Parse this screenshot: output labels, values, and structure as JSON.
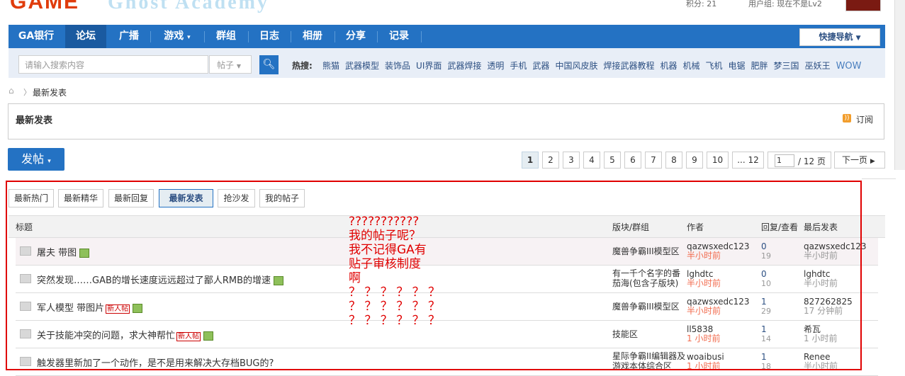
{
  "header": {
    "logo_text": "GAME",
    "logo_sub": "Ghost Academy",
    "credits": "积分: 21",
    "user_group": "用户组: 现在不是Lv2"
  },
  "nav": {
    "items": [
      "GA银行",
      "论坛",
      "广播",
      "游戏",
      "群组",
      "日志",
      "相册",
      "分享",
      "记录"
    ],
    "active_index": 1,
    "quick_nav": "快捷导航"
  },
  "search": {
    "placeholder": "请输入搜索内容",
    "type": "帖子",
    "hot_label": "热搜:",
    "hot_words": [
      "熊猫",
      "武器模型",
      "装饰品",
      "UI界面",
      "武器焊接",
      "透明",
      "手机",
      "武器",
      "中国风皮肤",
      "焊接武器教程",
      "机器",
      "机械",
      "飞机",
      "电锯",
      "肥胖",
      "梦三国",
      "巫妖王",
      "WOW"
    ]
  },
  "breadcrumb": {
    "current": "最新发表"
  },
  "page": {
    "title": "最新发表",
    "subscribe": "订阅",
    "post_button": "发帖"
  },
  "pagination": {
    "pages": [
      "1",
      "2",
      "3",
      "4",
      "5",
      "6",
      "7",
      "8",
      "9",
      "10",
      "... 12"
    ],
    "current": "1",
    "input_value": "1",
    "total": "/ 12 页",
    "next": "下一页"
  },
  "filters": {
    "tabs": [
      "最新热门",
      "最新精华",
      "最新回复",
      "最新发表",
      "抢沙发",
      "我的帖子"
    ],
    "active_index": 3
  },
  "table": {
    "headers": {
      "subject": "标题",
      "forum": "版块/群组",
      "author": "作者",
      "replies": "回复/查看",
      "last": "最后发表"
    },
    "rows": [
      {
        "subject": "屠夫 带图",
        "new": "",
        "img": true,
        "forum": "魔兽争霸III模型区",
        "author": "qazwsxedc123",
        "author_time": "半小时前",
        "replies": "0",
        "views": "19",
        "last_user": "qazwsxedc123",
        "last_time": "半小时前"
      },
      {
        "subject": "突然发现……GAB的增长速度远远超过了鄙人RMB的增速",
        "new": "",
        "img": true,
        "forum": "有一千个名字的番茄海(包含子版块)",
        "author": "lghdtc",
        "author_time": "半小时前",
        "replies": "0",
        "views": "10",
        "last_user": "lghdtc",
        "last_time": "半小时前"
      },
      {
        "subject": "军人模型 带图片",
        "new": "新人帖",
        "img": true,
        "forum": "魔兽争霸III模型区",
        "author": "qazwsxedc123",
        "author_time": "半小时前",
        "replies": "1",
        "views": "29",
        "last_user": "827262825",
        "last_time": "17 分钟前"
      },
      {
        "subject": "关于技能冲突的问题，求大神帮忙",
        "new": "新人帖",
        "img": true,
        "forum": "技能区",
        "author": "ll5838",
        "author_time": "1 小时前",
        "replies": "1",
        "views": "14",
        "last_user": "希瓦",
        "last_time": "1 小时前"
      },
      {
        "subject": "触发器里新加了一个动作，是不是用来解决大存档BUG的?",
        "new": "",
        "img": false,
        "forum": "星际争霸II编辑器及游戏本体综合区",
        "author": "woaibusi",
        "author_time": "1 小时前",
        "replies": "1",
        "views": "18",
        "last_user": "Renee",
        "last_time": "半小时前"
      }
    ]
  },
  "annotation": {
    "text": "???????????\n我的帖子呢？\n我不记得GA有\n贴子审核制度\n啊\n？ ？ ？ ？ ？ ？\n？ ？ ？ ？ ？ ？\n？ ？ ？ ？ ？ ？",
    "color": "#e00000"
  },
  "colors": {
    "nav": "#2472c3",
    "link": "#2c4f82",
    "time": "#f26c4f"
  }
}
